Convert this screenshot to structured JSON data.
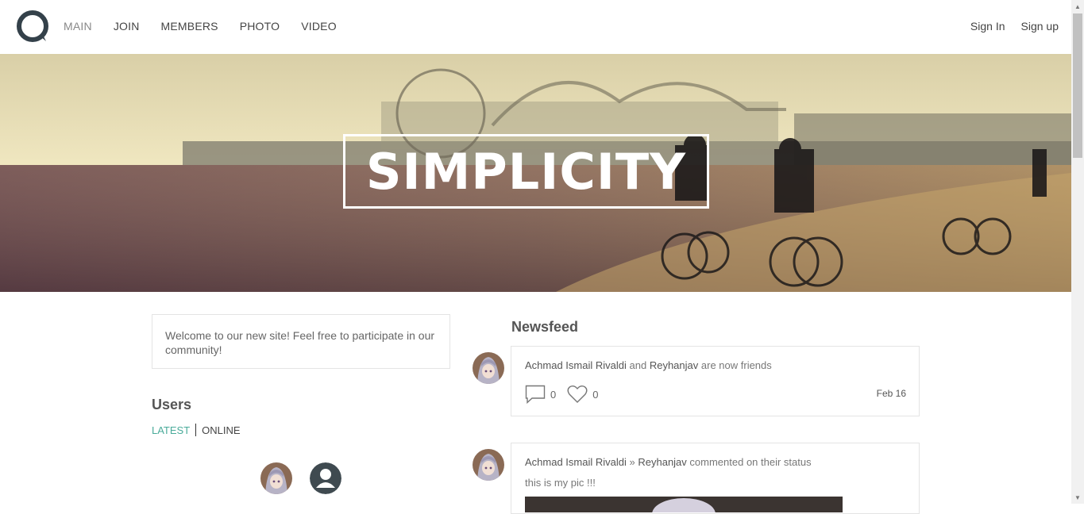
{
  "nav": {
    "items": [
      "MAIN",
      "JOIN",
      "MEMBERS",
      "PHOTO",
      "VIDEO"
    ],
    "sign_in": "Sign In",
    "sign_up": "Sign up"
  },
  "hero": {
    "title": "SIMPLICITY"
  },
  "welcome": {
    "text": "Welcome to our new site! Feel free to participate in our community!"
  },
  "users": {
    "title": "Users",
    "tab_latest": "LATEST",
    "tab_online": "ONLINE"
  },
  "newsfeed": {
    "title": "Newsfeed",
    "items": [
      {
        "actor": "Achmad Ismail Rivaldi",
        "joiner": "and",
        "target": "Reyhanjav",
        "action": "are now friends",
        "comments": "0",
        "likes": "0",
        "date": "Feb 16"
      },
      {
        "actor": "Achmad Ismail Rivaldi",
        "joiner": "»",
        "target": "Reyhanjav",
        "action": "commented on their status",
        "body": "this is my pic !!!"
      }
    ]
  },
  "colors": {
    "accent": "#4aab9a",
    "border": "#e4e4e4"
  }
}
